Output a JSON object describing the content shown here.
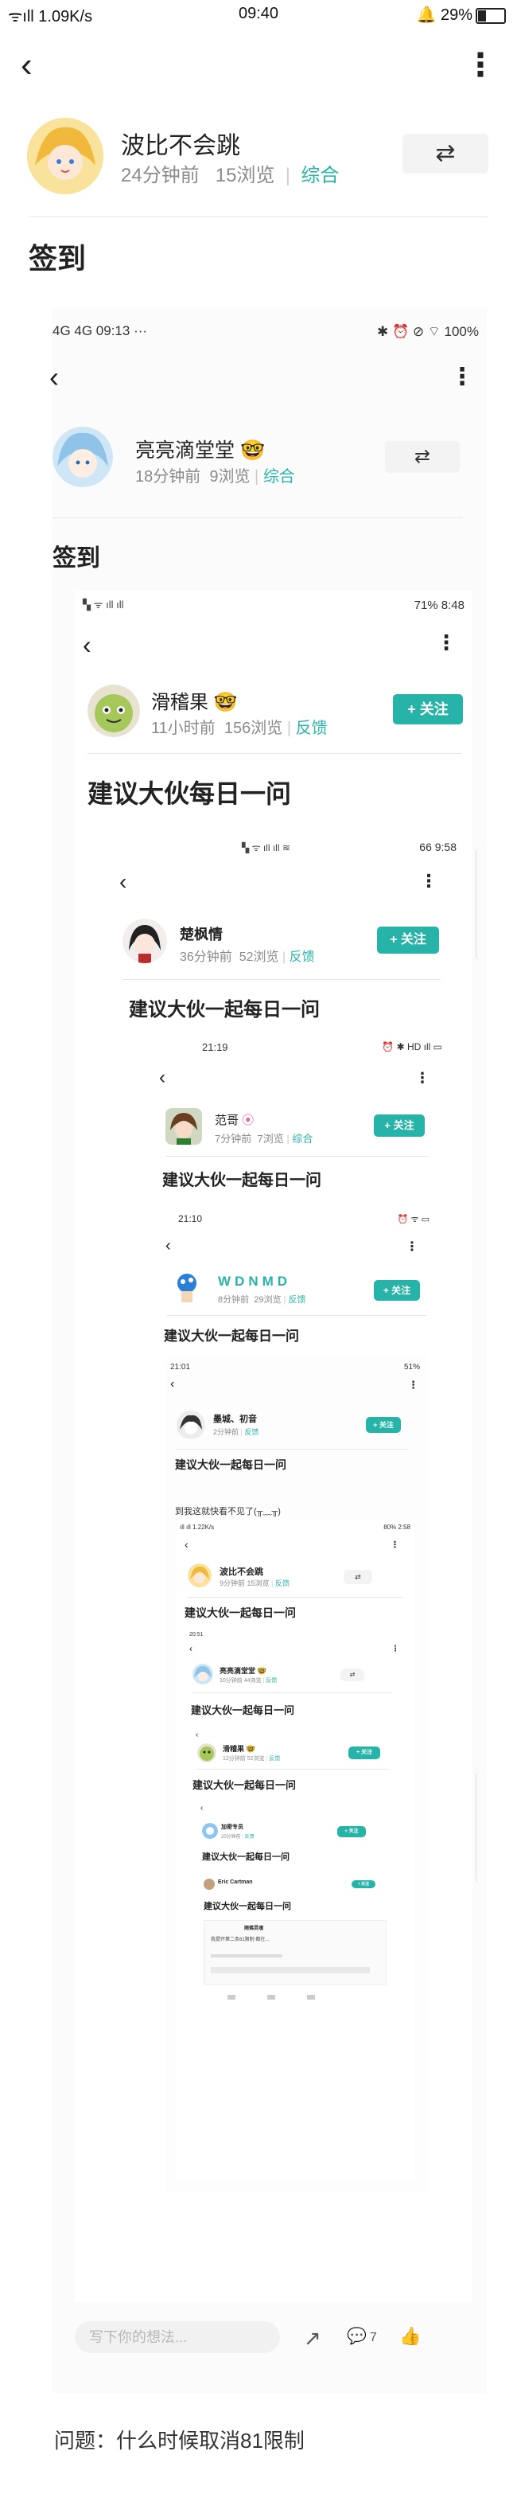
{
  "status": {
    "signal": "ᯤıll 1.09K/s",
    "time": "09:40",
    "icons": "🔔 29%"
  },
  "post": {
    "author": "波比不会跳",
    "time_ago": "24分钟前",
    "views": "15浏览",
    "category": "综合",
    "title": "签到",
    "question": "问题：什么时候取消81限制"
  },
  "level1": {
    "status_left": "4G 4G 09:13 ···",
    "status_right": "✱ ⏰ ⊘ ⌔ 100%",
    "author": "亮亮滴堂堂",
    "time_ago": "18分钟前",
    "views": "9浏览",
    "category": "综合",
    "title": "签到"
  },
  "level2": {
    "status_right": "71% 8:48",
    "author": "滑稽果",
    "time_ago": "11小时前",
    "views": "156浏览",
    "category": "反馈",
    "follow": "+ 关注",
    "title": "建议大伙每日一问"
  },
  "level3": {
    "status_right": "66 9:58",
    "author": "楚枫情",
    "time_ago": "36分钟前",
    "views": "52浏览",
    "category": "反馈",
    "follow": "+ 关注",
    "title": "建议大伙一起每日一问"
  },
  "level4": {
    "status_time": "21:19",
    "status_right": "⏰ ✱ HD ıll ▭",
    "author": "范哥",
    "time_ago": "7分钟前",
    "views": "7浏览",
    "category": "综合",
    "follow": "+ 关注",
    "title": "建议大伙一起每日一问"
  },
  "level5": {
    "status_time": "21:10",
    "author": "WDNMD",
    "time_ago": "8分钟前",
    "views": "29浏览",
    "category": "反馈",
    "follow": "+ 关注",
    "title": "建议大伙一起每日一问"
  },
  "level6": {
    "status_time": "21:01",
    "status_right": "51%",
    "author": "墨城、初音",
    "time_ago": "2分钟前",
    "category": "反馈",
    "follow": "+ 关注",
    "title": "建议大伙一起每日一问",
    "caption": "到我这就快看不见了(╥﹏╥)"
  },
  "level7": {
    "status_left": "1.22K/s",
    "status_right": "80% 2:58",
    "author": "波比不会跳",
    "time_ago": "9分钟前",
    "views": "15浏览",
    "category": "反馈",
    "title": "建议大伙一起每日一问"
  },
  "level8": {
    "status_time": "20:51",
    "author": "亮亮滴堂堂",
    "time_ago": "10分钟前",
    "views": "44浏览",
    "category": "反馈",
    "title": "建议大伙一起每日一问"
  },
  "level9": {
    "author": "滑稽果",
    "time_ago": "12分钟前",
    "views": "52浏览",
    "category": "反馈",
    "follow": "+ 关注",
    "title": "建议大伙一起每日一问"
  },
  "level10": {
    "author": "加密专员",
    "time_ago": "20分钟前",
    "category": "反馈",
    "follow": "+ 关注",
    "title": "建议大伙一起每日一问"
  },
  "level11": {
    "author": "Eric Cartman",
    "title": "建议大伙一起每日一问",
    "sub_author": "雨佛灵魂",
    "sub_text": "我提开第二条81限制 都在..."
  },
  "bottom_bar": {
    "placeholder": "写下你的想法...",
    "comment_count": "7"
  }
}
